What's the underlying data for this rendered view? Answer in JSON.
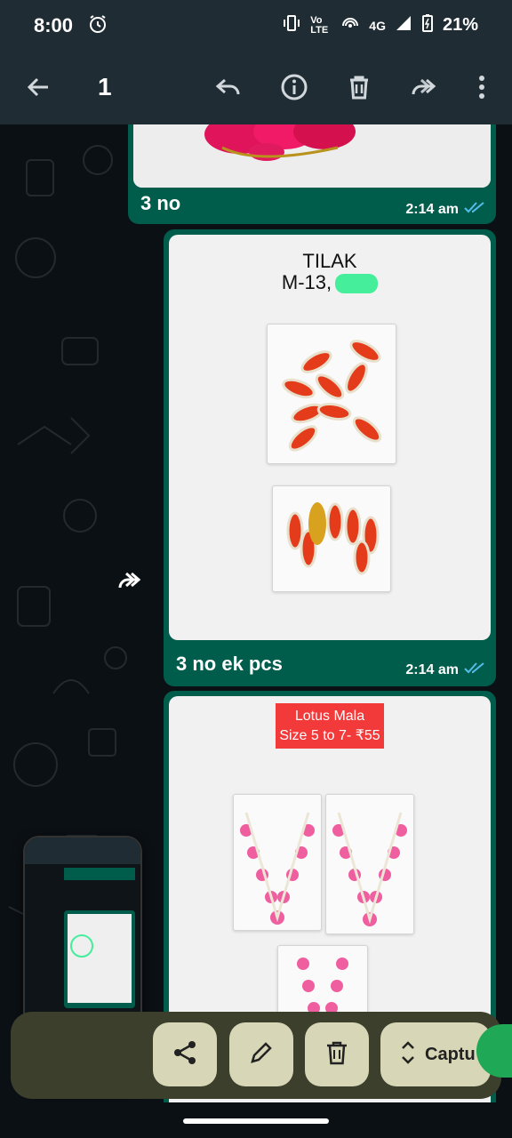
{
  "status_bar": {
    "time": "8:00",
    "network": "4G",
    "volte": "Vo LTE",
    "battery": "21%"
  },
  "app_bar": {
    "selected_count": "1",
    "icons": [
      "back-arrow-icon",
      "reply-icon",
      "info-icon",
      "delete-icon",
      "forward-icon",
      "more-vert-icon"
    ]
  },
  "messages": [
    {
      "caption": "3 no",
      "time": "2:14 am"
    },
    {
      "caption": "3 no ek pcs",
      "time": "2:14 am",
      "image_text": {
        "title": "TILAK",
        "code": "M-13,"
      }
    },
    {
      "image_text": {
        "label_line1": "Lotus Mala",
        "label_line2": "Size 5 to 7- ₹55"
      }
    }
  ],
  "screenshot_toolbar": {
    "capture_label": "Captu",
    "icons": [
      "share-icon",
      "edit-icon",
      "delete-icon",
      "expand-icon"
    ]
  },
  "colors": {
    "header_bg": "#1f2c34",
    "bubble_bg": "#005c4b",
    "chat_bg": "#0b1014",
    "read_tick": "#53bdeb",
    "toolbar_bg": "#3b3f2c",
    "tool_bg": "#d7d6b6"
  }
}
